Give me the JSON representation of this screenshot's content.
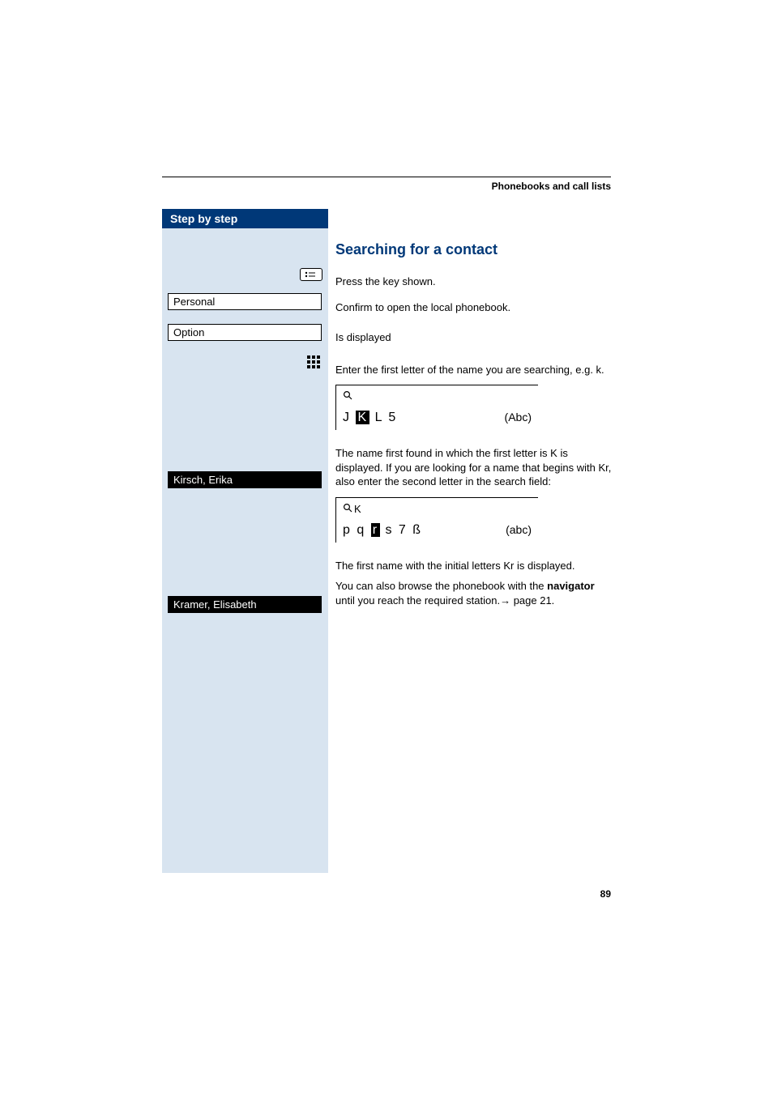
{
  "header": {
    "section": "Phonebooks and call lists"
  },
  "sidebar": {
    "title": "Step by step",
    "boxes": {
      "personal": "Personal",
      "option": "Option",
      "kirsch": "Kirsch, Erika",
      "kramer": "Kramer, Elisabeth"
    }
  },
  "content": {
    "title": "Searching for a contact",
    "press_key": "Press the key shown.",
    "confirm_open": "Confirm to open the local phonebook.",
    "is_displayed": "Is displayed",
    "enter_first": "Enter the first letter of the name you are searching, e.g. k.",
    "search1": {
      "query_prefix": "",
      "letters_before": "J ",
      "highlight": "K",
      "letters_after": " L 5",
      "mode": "(Abc)"
    },
    "first_found": "The name first found in which the first letter is K is displayed. If you are looking for a name that begins with Kr, also enter the second letter in the search field:",
    "search2": {
      "query_prefix": "K",
      "letters_before": "p q ",
      "highlight": "r",
      "letters_after": " s 7 ß",
      "mode": "(abc)"
    },
    "kr_displayed": "The first name with the initial letters Kr is displayed.",
    "browse_pre": "You can also browse the phonebook with the ",
    "browse_bold": "navigator",
    "browse_post": " until you reach the required station.",
    "arrow": "→",
    "page_ref": " page 21."
  },
  "page_number": "89"
}
